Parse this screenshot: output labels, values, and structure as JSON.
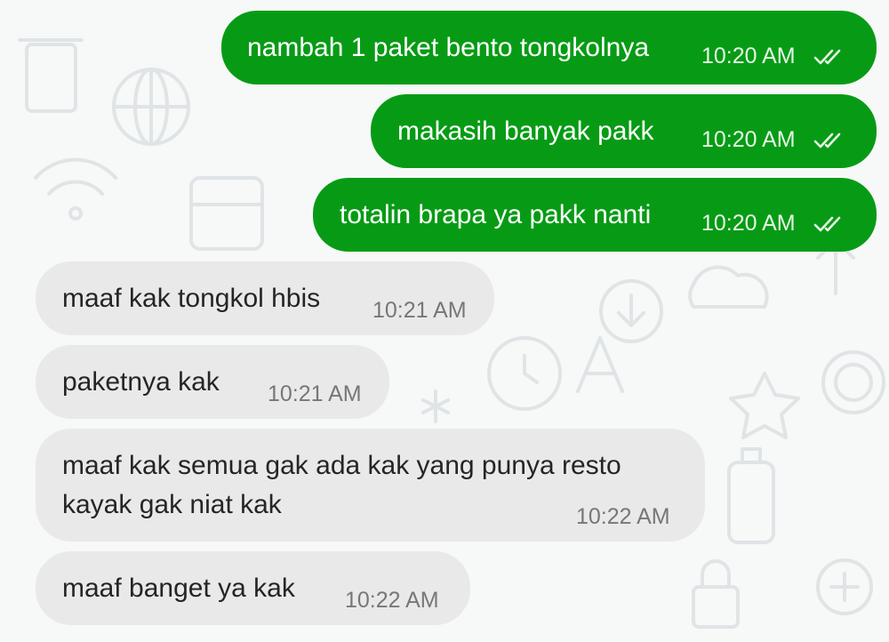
{
  "chat": {
    "messages": [
      {
        "direction": "outgoing",
        "text": "nambah 1 paket bento tongkolnya",
        "time": "10:20 AM",
        "status": "read-double-check-icon"
      },
      {
        "direction": "outgoing",
        "text": "makasih banyak pakk",
        "time": "10:20 AM",
        "status": "read-double-check-icon"
      },
      {
        "direction": "outgoing",
        "text": "totalin brapa ya pakk nanti",
        "time": "10:20 AM",
        "status": "read-double-check-icon"
      },
      {
        "direction": "incoming",
        "text": "maaf kak tongkol hbis",
        "time": "10:21 AM"
      },
      {
        "direction": "incoming",
        "text": "paketnya kak",
        "time": "10:21 AM"
      },
      {
        "direction": "incoming",
        "lines": [
          "maaf kak semua gak ada kak yang punya resto",
          "kayak gak niat kak"
        ],
        "time": "10:22 AM"
      },
      {
        "direction": "incoming",
        "text": "maaf banget ya kak",
        "time": "10:22 AM"
      }
    ]
  },
  "colors": {
    "outgoing_bubble": "#079b15",
    "incoming_bubble": "#e9e9ea",
    "background": "#f7f8f8"
  }
}
